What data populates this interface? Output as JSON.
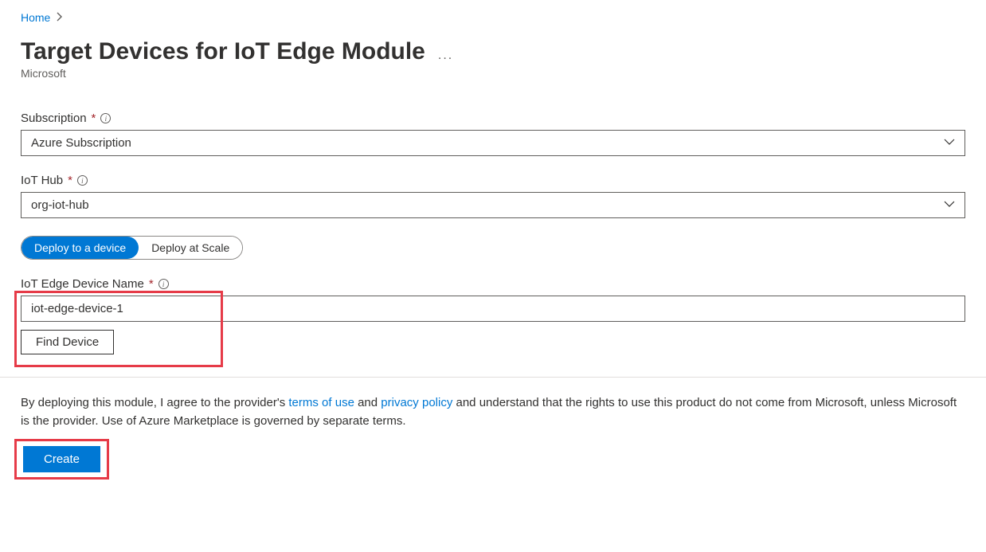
{
  "breadcrumb": {
    "home": "Home"
  },
  "header": {
    "title": "Target Devices for IoT Edge Module",
    "subtitle": "Microsoft",
    "ellipsis": "..."
  },
  "fields": {
    "subscription": {
      "label": "Subscription",
      "value": "Azure Subscription"
    },
    "iothub": {
      "label": "IoT Hub",
      "value": "org-iot-hub"
    },
    "deploy_toggle": {
      "device": "Deploy to a device",
      "scale": "Deploy at Scale"
    },
    "device_name": {
      "label": "IoT Edge Device Name",
      "value": "iot-edge-device-1",
      "find_button": "Find Device"
    }
  },
  "footer": {
    "text_part1": "By deploying this module, I agree to the provider's ",
    "terms_link": "terms of use",
    "text_part2": " and ",
    "privacy_link": "privacy policy",
    "text_part3": " and understand that the rights to use this product do not come from Microsoft, unless Microsoft is the provider. Use of Azure Marketplace is governed by separate terms.",
    "create_button": "Create"
  }
}
